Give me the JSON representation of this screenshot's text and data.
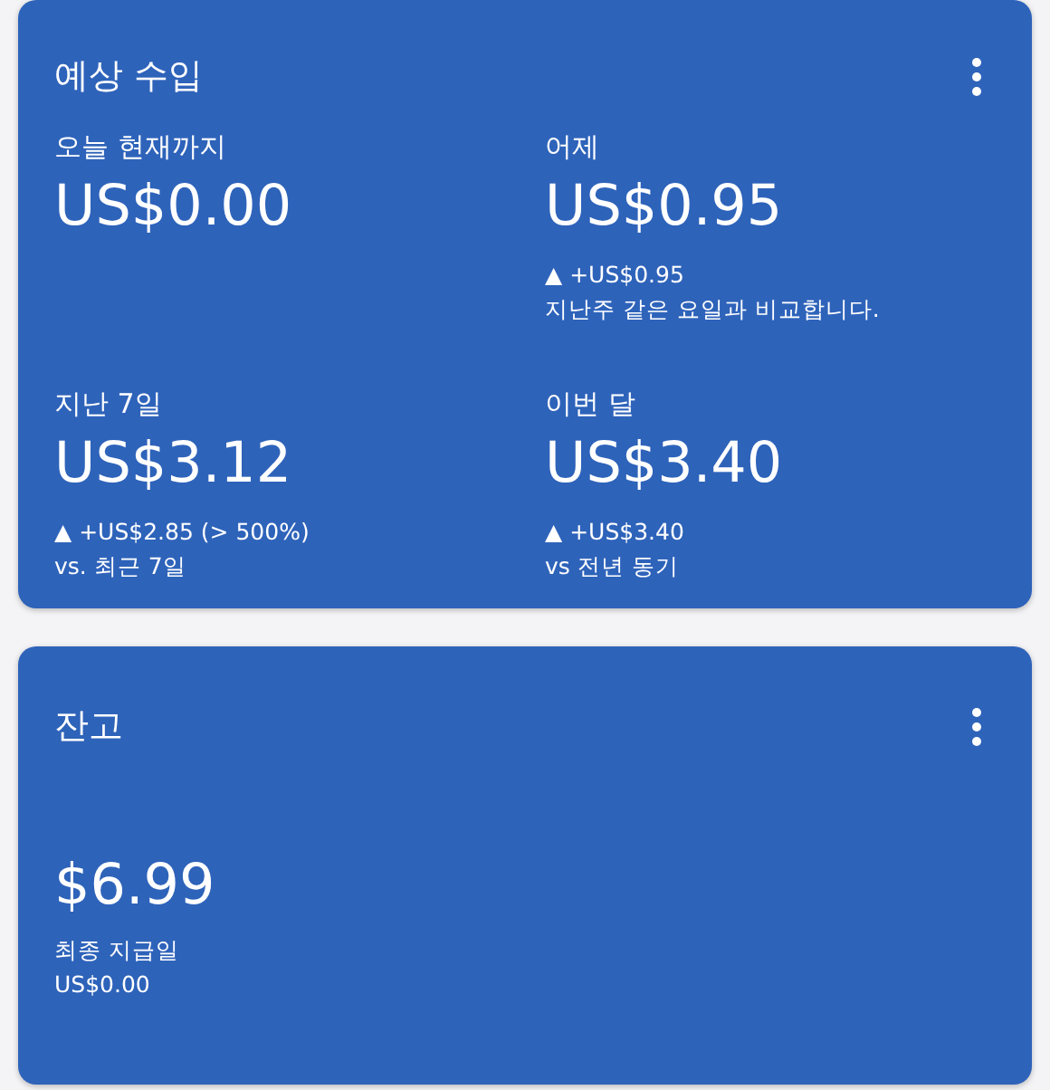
{
  "cards": [
    {
      "title": "예상 수입",
      "metrics": [
        {
          "label": "오늘 현재까지",
          "value": "US$0.00"
        },
        {
          "label": "어제",
          "value": "US$0.95",
          "change": "▲ +US$0.95",
          "note": "지난주 같은 요일과 비교합니다."
        },
        {
          "label": "지난 7일",
          "value": "US$3.12",
          "change": "▲ +US$2.85 (> 500%)",
          "note": "vs. 최근 7일"
        },
        {
          "label": "이번 달",
          "value": "US$3.40",
          "change": "▲ +US$3.40",
          "note": "vs 전년 동기"
        }
      ]
    },
    {
      "title": "잔고",
      "balance": "$6.99",
      "last_payment_label": "최종 지급일",
      "last_payment_value": "US$0.00"
    }
  ]
}
